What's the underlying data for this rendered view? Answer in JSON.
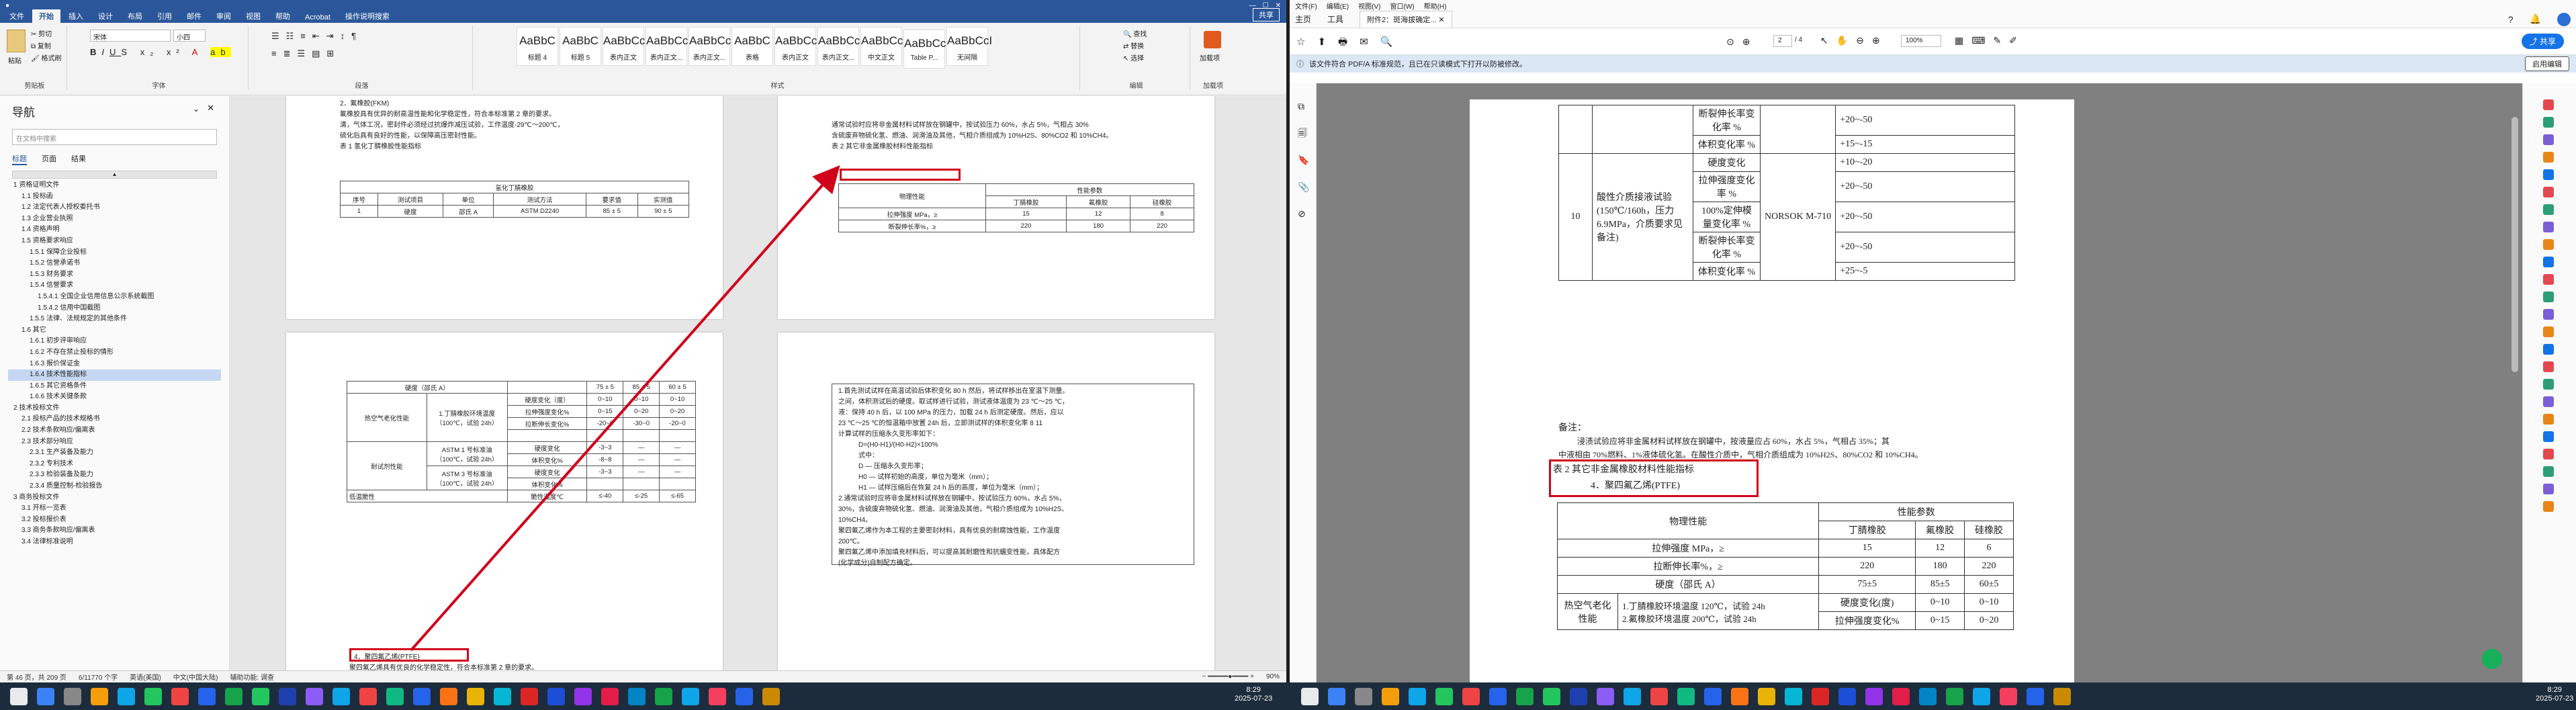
{
  "word": {
    "title_left": "文件",
    "tabs": [
      "文件",
      "开始",
      "插入",
      "设计",
      "布局",
      "引用",
      "邮件",
      "审阅",
      "视图",
      "帮助",
      "Acrobat",
      "操作说明搜索"
    ],
    "share": "共享",
    "ribbon": {
      "clipboard": "剪贴板",
      "paste": "粘贴",
      "cut": "剪切",
      "copy": "复制",
      "format_painter": "格式刷",
      "font_group": "字体",
      "font_name": "宋体",
      "font_size": "小四",
      "para_group": "段落",
      "styles_group": "样式",
      "edit_group": "编辑",
      "find": "查找",
      "replace": "替换",
      "select": "选择",
      "addin": "加载项",
      "addin_btn": "加载项",
      "styles": [
        {
          "sample": "AaBbC",
          "name": "标题 4"
        },
        {
          "sample": "AaBbC",
          "name": "标题 5"
        },
        {
          "sample": "AaBbCcI",
          "name": "表内正文"
        },
        {
          "sample": "AaBbCcI",
          "name": "表内正文..."
        },
        {
          "sample": "AaBbCcI",
          "name": "表内正文..."
        },
        {
          "sample": "AaBbC",
          "name": "表格"
        },
        {
          "sample": "AaBbCcI",
          "name": "表内正文"
        },
        {
          "sample": "AaBbCcI",
          "name": "表内正文..."
        },
        {
          "sample": "AaBbCcI",
          "name": "中文正文"
        },
        {
          "sample": "AaBbCcI",
          "name": "Table P..."
        },
        {
          "sample": "AaBbCcI",
          "name": "无间隔"
        }
      ]
    },
    "nav": {
      "title": "导航",
      "search_placeholder": "在文档中搜索",
      "tabs": [
        "标题",
        "页面",
        "结果"
      ],
      "items": [
        "1 资格证明文件",
        "1.1 投标函",
        "1.2 法定代表人授权委托书",
        "1.3 企业营业执照",
        "1.4 资格声明",
        "1.5 资格要求响应",
        "1.5.1 保障企业投标",
        "1.5.2 信誉承诺书",
        "1.5.3 财务要求",
        "1.5.4 信誉要求",
        "1.5.4.1 全国企业信用信息公示系统截图",
        "1.5.4.2 信用中国截图",
        "1.5.5 法律、法规规定的其他条件",
        "1.6 其它",
        "1.6.1 初步评审响应",
        "1.6.2 不存在禁止投标的情形",
        "1.6.3 报价保证金",
        "1.6.4 技术性能指标",
        "1.6.5 其它资格条件",
        "1.6.6 技术关键条款",
        "2 技术投标文件",
        "2.1 投标产品的技术规格书",
        "2.2 技术条款响应/偏离表",
        "2.3 技术部分响应",
        "2.3.1 生产装备及能力",
        "2.3.2 专利技术",
        "2.3.3 检验装备及能力",
        "2.3.4 质量控制-检验报告",
        "3 商务投标文件",
        "3.1 开标一览表",
        "3.2 投标报价表",
        "3.3 商务条款响应/偏离表",
        "3.4 法律标准说明"
      ],
      "selected_index": 17
    },
    "status": {
      "page": "第 46 页，共 209 页",
      "words": "6/11770 个字",
      "lang": "英语(美国)",
      "input": "中文(中国大陆)",
      "access": "辅助功能: 调查",
      "zoom": "90%"
    }
  },
  "doc": {
    "p1_lines": [
      "2．氟橡胶(FKM)",
      "氟橡胶具有优异的耐高温性能和化学稳定性，符合本标准第 2 章的要求。",
      "清，气体工况，密封件必须经过抗爆炸减压试验，工作温度-29℃～200℃，",
      "硫化后具有良好的性能，以保障高压密封性能。",
      "表 1 氢化丁腈橡胶性能指标"
    ],
    "t1_title": "氢化丁腈橡胶",
    "t1_rows": [
      [
        "序号",
        "测试项目",
        "单位",
        "测试方法",
        "要求值",
        "实测值"
      ],
      [
        "1",
        "硬度",
        "邵氏 A",
        "ASTM D2240",
        "85 ± 5",
        "90 ± 5"
      ]
    ],
    "p2_lines": [
      "通常试验时应将非金属材料试样放在钢罐中，按试验压力 60%，水占 5%，气相占 30%",
      "含硫废弃物硫化氢、燃油、润滑油及其他，气相介质组成为 10%H2S、80%CO2 和 10%CH4。",
      "表 2 其它非金属橡胶材料性能指标"
    ],
    "t2_head": [
      "物理性能",
      "性能参数",
      "丁腈橡胶",
      "氟橡胶",
      "硅橡胶"
    ],
    "t2_rows": [
      [
        "拉伸强度 MPa，≥",
        "15",
        "12",
        "8"
      ],
      [
        "断裂伸长率%，≥",
        "220",
        "180",
        "220"
      ]
    ],
    "t3_rows": [
      [
        "硬度（邵氏 A）",
        "",
        "75 ± 5",
        "85 ± 5",
        "60 ± 5"
      ],
      [
        "热空气老化性能",
        "1.丁腈橡胶环境温度（100℃，试验 24h）",
        "硬度变化（度）",
        "0~10",
        "0~10",
        "0~10"
      ],
      [
        "",
        "",
        "拉伸强度变化%",
        "0~15",
        "0~20",
        "0~20"
      ],
      [
        "",
        "",
        "拉断伸长变化%",
        "-20~0",
        "-30~0",
        "-20~0"
      ],
      [
        "耐试剂性能",
        "ASTM 1 号标准油（100℃，试验 24h）",
        "硬度变化",
        "-3~3",
        "—",
        "—"
      ],
      [
        "",
        "",
        "体积变化%",
        "-8~8",
        "—",
        "—"
      ],
      [
        "",
        "ASTM 3 号标准油（100℃，试验 24h）",
        "硬度变化",
        "-3~3",
        "—",
        "—"
      ],
      [
        "",
        "",
        "体积变化%",
        "",
        "",
        ""
      ],
      [
        "低温脆性",
        "",
        "脆性温度℃",
        "≤-40",
        "≤-25",
        "≤-65"
      ]
    ],
    "t3_note": "4．聚四氟乙烯(PTFE)",
    "p3_last": "聚四氟乙烯具有优良的化学稳定性，符合本标准第 2 章的要求。",
    "p4_lines": [
      "1.首先测试试样在高温试验后体积变化 80 h 然后，将试样移出在室温下测量。",
      "之间，体积测试后的硬度。取试样进行试验，测试液体温度为 23 ℃～25 ℃，",
      "液：保持 40 h 后，以 100 MPa 的压力，加载 24 h 后测定硬度。然后，应以",
      "23 ℃～25 ℃的恒温箱中放置 24h 后，立即测试样的体积变化率 8 11",
      "计算试样的压缩永久变形率如下：",
      "D=(H0-H1)/(H0-H2)×100%",
      "式中：",
      "D — 压缩永久变形率；",
      "H0 — 试样初始的高度，单位为毫米（mm）；",
      "H1 — 试样压缩后在恢复 24 h 后的高度，单位为毫米（mm）；",
      "2.通常试验时应将非金属材料试样放在钢罐中，按试验压力 60%，水占 5%，",
      "30%，含硫废弃物硫化氢、燃油、润滑油及其他，气相介质组成为 10%H2S、",
      "10%CH4。",
      "聚四氟乙烯作为本工程的主要密封材料，具有优良的耐腐蚀性能，工作温度",
      "200℃。",
      "聚四氟乙烯中添加填充材料后，可以提高其耐磨性和抗蠕变性能，具体配方",
      "(化学成分)自制配方确定。"
    ]
  },
  "pdf": {
    "menu": [
      "文件(F)",
      "编辑(E)",
      "视图(V)",
      "窗口(W)",
      "帮助(H)"
    ],
    "tabs": [
      "主页",
      "工具"
    ],
    "doc_tab": "附件2：斑海拔确定...",
    "page_now": "2",
    "page_total": "/ 4",
    "zoom": "100%",
    "share": "共享",
    "banner": "该文件符合 PDF/A 标准规范，且已在只读模式下打开以防被修改。",
    "enable_edit": "启用编辑",
    "t_top": [
      [
        "",
        "断裂伸长率变化率 %",
        "",
        "+20~-50"
      ],
      [
        "",
        "体积变化率 %",
        "",
        "+15~-15"
      ],
      [
        "10",
        "酸性介质接液试验(150℃/160h，压力 6.9MPa，介质要求见备注)",
        "硬度变化",
        "NORSOK M-710",
        "+10~-20"
      ],
      [
        "",
        "",
        "拉伸强度变化率 %",
        "",
        "+20~-50"
      ],
      [
        "",
        "",
        "100%定伸模量变化率 %",
        "",
        "+20~-50"
      ],
      [
        "",
        "",
        "断裂伸长率变化率 %",
        "",
        "+20~-50"
      ],
      [
        "",
        "",
        "体积变化率 %",
        "",
        "+25~-5"
      ]
    ],
    "note": "备注：",
    "note_text": "浸渍试验应将非金属材料试样放在钢罐中，按液量应占 60%，水占 5%，气相占 35%；其",
    "note_text2": "中液相由 70%燃料、1%液体硫化氢。在酸性介质中，气相介质组成为 10%H2S、80%CO2 和 10%CH4。",
    "table2_caption": "表 2 其它非金属橡胶材料性能指标",
    "ptfe": "4．聚四氟乙烯(PTFE)",
    "t2_head": [
      "物理性能",
      "性能参数",
      "丁腈橡胶",
      "氟橡胶",
      "硅橡胶"
    ],
    "t2_rows": [
      [
        "拉伸强度 MPa，≥",
        "15",
        "12",
        "6"
      ],
      [
        "拉断伸长率%，≥",
        "220",
        "180",
        "220"
      ],
      [
        "硬度（邵氏 A）",
        "75±5",
        "85±5",
        "60±5"
      ]
    ],
    "t2_aging": [
      "热空气老化性能",
      "1.丁腈橡胶环境温度 120℃，试验 24h",
      "2.氟橡胶环境温度 200℃，试验 24h",
      "硬度变化(度)",
      "0~10",
      "0~10",
      "0~10",
      "拉伸强度变化%",
      "0~15",
      "0~20",
      "0~20"
    ]
  },
  "clock": {
    "left_time": "8:29",
    "left_date": "2025-07-23",
    "right_time": "8:29",
    "right_date": "2025-07-23"
  },
  "colors": {
    "word_blue": "#2b579a",
    "annotation_red": "#d0021b"
  }
}
